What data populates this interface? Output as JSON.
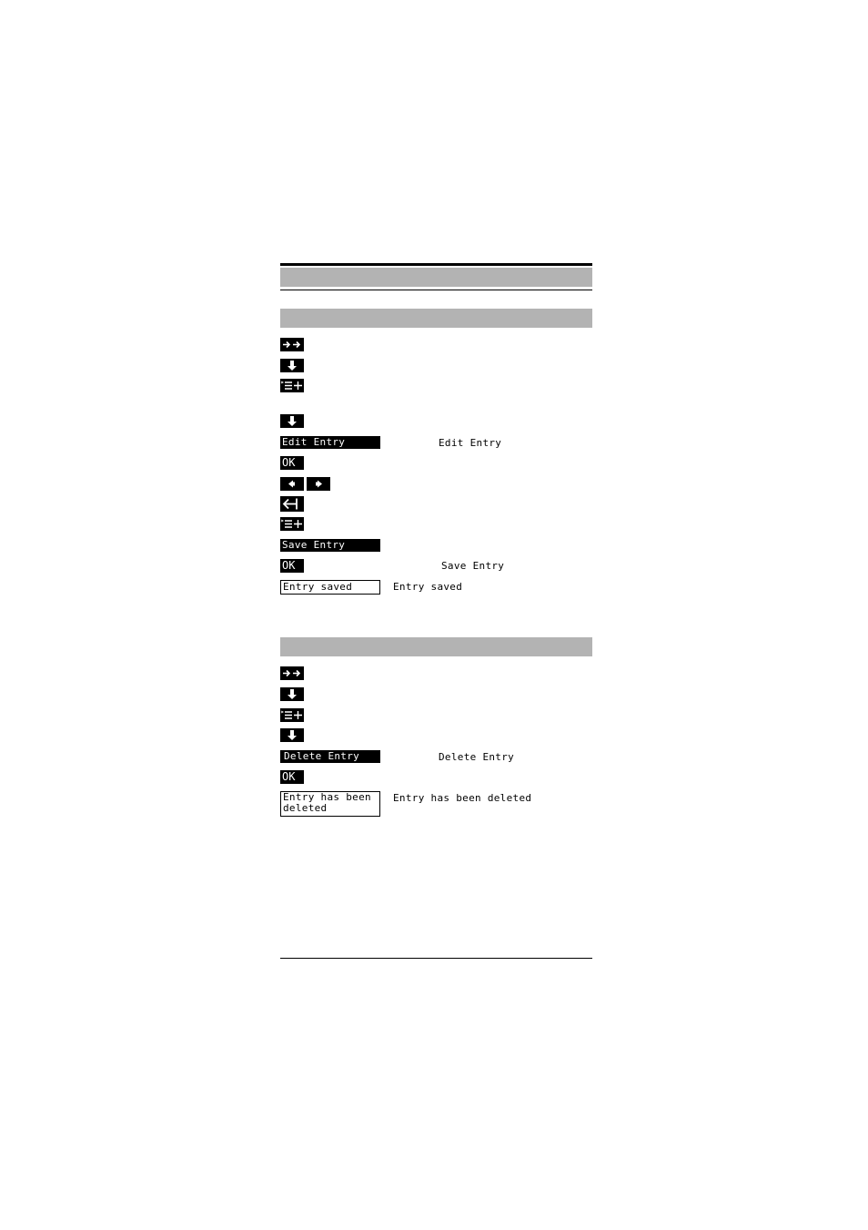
{
  "colors": {
    "band": "#b3b3b3",
    "key_bg": "#000000",
    "key_fg": "#ffffff"
  },
  "section_edit": {
    "steps": [
      {
        "icon": "forward-arrows-icon"
      },
      {
        "icon": "down-arrow-icon"
      },
      {
        "icon": "menu-list-plus-icon"
      },
      {
        "icon": "down-arrow-icon"
      },
      {
        "display": "Edit Entry",
        "desc": "Edit Entry"
      },
      {
        "key": "OK"
      },
      {
        "icon": "left-right-keys-icon"
      },
      {
        "icon": "backspace-icon"
      },
      {
        "icon": "menu-list-plus-icon"
      },
      {
        "display": "Save Entry"
      },
      {
        "key": "OK",
        "desc": "Save Entry"
      },
      {
        "display": "Entry saved",
        "desc": "Entry saved"
      }
    ]
  },
  "section_delete": {
    "steps": [
      {
        "icon": "forward-arrows-icon"
      },
      {
        "icon": "down-arrow-icon"
      },
      {
        "icon": "menu-list-plus-icon"
      },
      {
        "icon": "down-arrow-icon"
      },
      {
        "display": "Delete Entry",
        "desc": "Delete Entry"
      },
      {
        "key": "OK"
      },
      {
        "display": "Entry has been\ndeleted",
        "desc": "Entry has been deleted"
      }
    ]
  }
}
